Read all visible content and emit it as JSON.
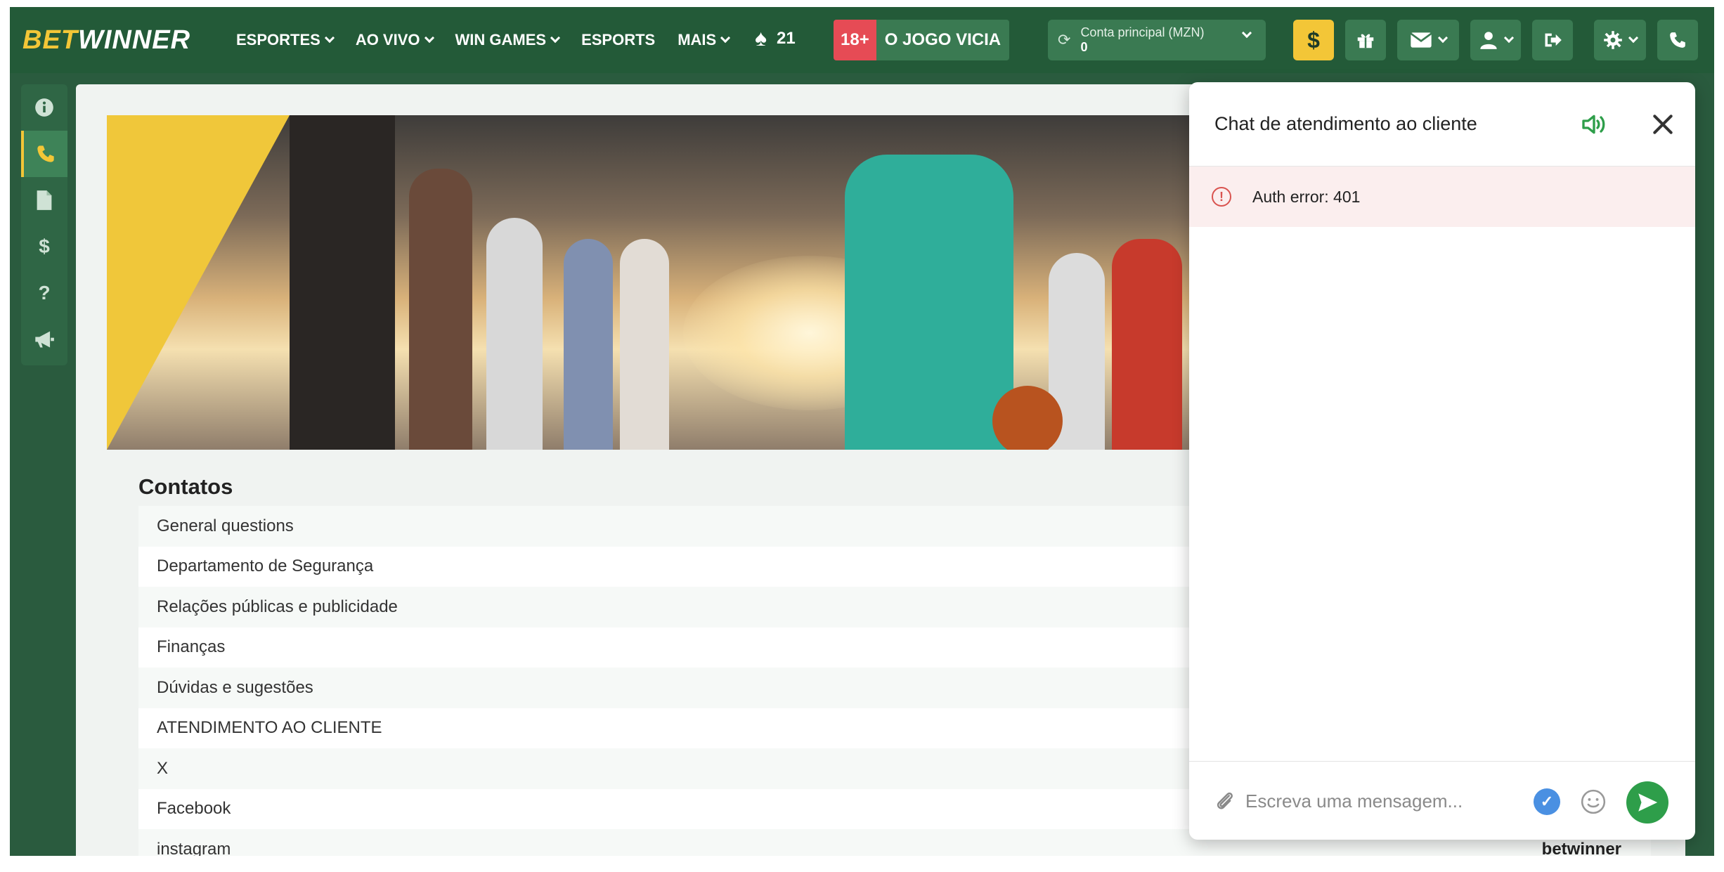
{
  "brand": {
    "bet": "BET",
    "winner": "WINNER"
  },
  "nav": {
    "items": [
      {
        "label": "ESPORTES",
        "has_dropdown": true
      },
      {
        "label": "AO VIVO",
        "has_dropdown": true
      },
      {
        "label": "WIN GAMES",
        "has_dropdown": true
      },
      {
        "label": "ESPORTS",
        "has_dropdown": false
      },
      {
        "label": "MAIS",
        "has_dropdown": true
      }
    ],
    "spade_count": "21",
    "age_badge": "18+",
    "age_text": "O JOGO VICIA"
  },
  "account": {
    "label": "Conta principal (MZN)",
    "balance": "0"
  },
  "toolbar": {
    "deposit_symbol": "$",
    "icons": [
      "dollar-icon",
      "gift-icon",
      "envelope-icon",
      "user-icon",
      "logout-icon",
      "gear-icon",
      "phone-icon"
    ]
  },
  "sidebar": {
    "icons": [
      "info-icon",
      "phone-icon",
      "document-icon",
      "dollar-icon",
      "question-icon",
      "megaphone-icon"
    ],
    "active_index": 1,
    "dollar_glyph": "$",
    "question_glyph": "?"
  },
  "contacts": {
    "title": "Contatos",
    "rows": [
      {
        "label": "General questions",
        "value": ""
      },
      {
        "label": "Departamento de Segurança",
        "value": ""
      },
      {
        "label": "Relações públicas e publicidade",
        "value": ""
      },
      {
        "label": "Finanças",
        "value": ""
      },
      {
        "label": "Dúvidas e sugestões",
        "value": ""
      },
      {
        "label": "ATENDIMENTO AO CLIENTE",
        "value": ""
      },
      {
        "label": "X",
        "value": ""
      },
      {
        "label": "Facebook",
        "value": ""
      },
      {
        "label": "instagram",
        "value": "betwinner"
      }
    ]
  },
  "chat": {
    "title": "Chat de atendimento ao cliente",
    "error": "Auth error: 401",
    "input_placeholder": "Escreva uma mensagem...",
    "error_glyph": "!",
    "check_glyph": "✓"
  },
  "colors": {
    "brand_green": "#235a38",
    "accent_yellow": "#f3c637",
    "age_red": "#e64b55",
    "send_green": "#2e9e4a"
  }
}
